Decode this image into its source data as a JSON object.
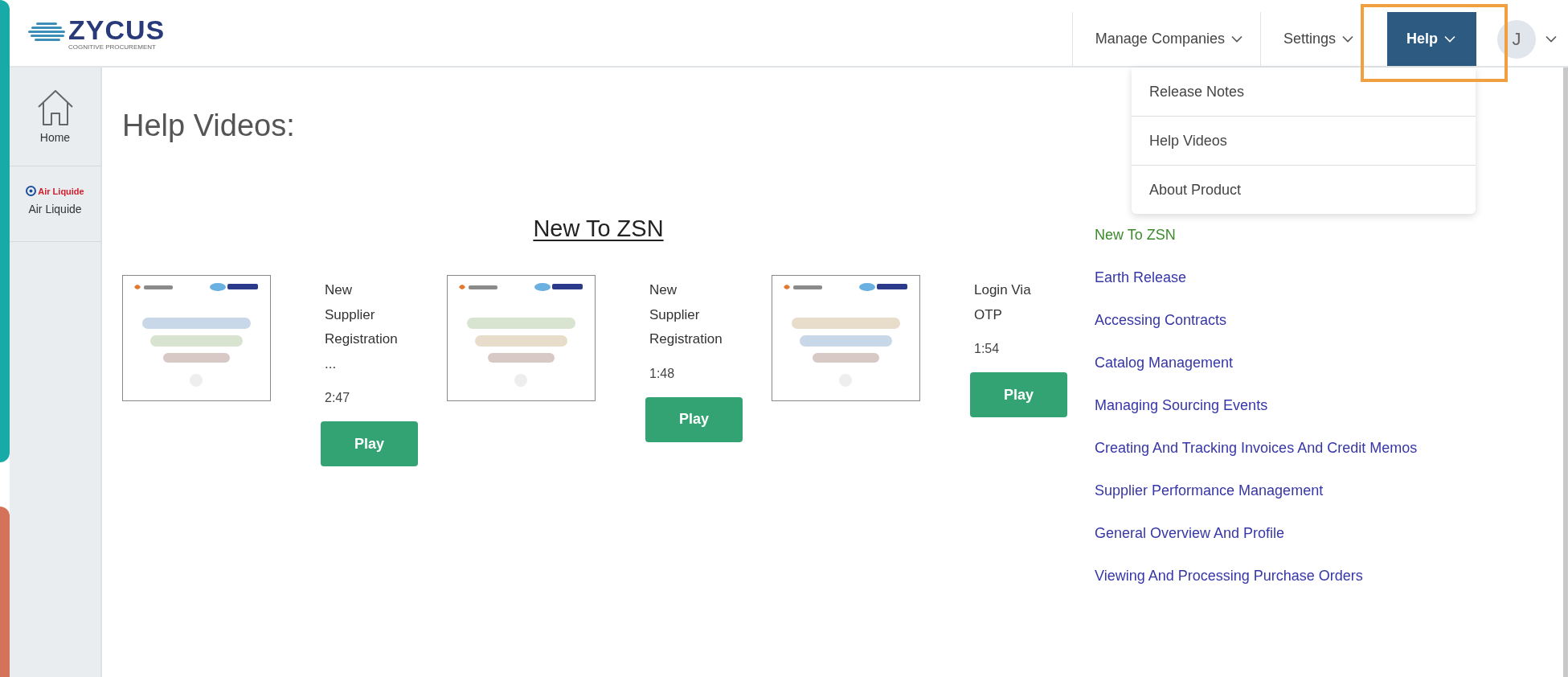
{
  "logo": {
    "name": "ZYCUS",
    "tagline": "COGNITIVE PROCUREMENT"
  },
  "nav": [
    {
      "label": "Manage Companies",
      "selected": false
    },
    {
      "label": "Settings",
      "selected": false
    },
    {
      "label": "Help",
      "selected": true
    }
  ],
  "user": {
    "initial": "J"
  },
  "help_menu": [
    "Release Notes",
    "Help Videos",
    "About Product"
  ],
  "sidebar": [
    {
      "kind": "home",
      "label": "Home"
    },
    {
      "kind": "company",
      "label": "Air Liquide",
      "logo_text": "Air Liquide"
    }
  ],
  "page_title": "Help Videos:",
  "section_title": "New To ZSN",
  "videos": [
    {
      "kind": "picture",
      "title": "New Supplier Registration ...",
      "duration": "2:47",
      "button": "Play"
    },
    {
      "kind": "picture",
      "title": "New Supplier Registration",
      "duration": "1:48",
      "button": "Play"
    },
    {
      "kind": "picture",
      "title": "Login Via OTP",
      "duration": "1:54",
      "button": "Play"
    }
  ],
  "topics": [
    {
      "label": "New To ZSN",
      "selected": true
    },
    {
      "label": "Earth Release",
      "selected": false
    },
    {
      "label": "Accessing Contracts",
      "selected": false
    },
    {
      "label": "Catalog Management",
      "selected": false
    },
    {
      "label": "Managing Sourcing Events",
      "selected": false
    },
    {
      "label": "Creating And Tracking Invoices And Credit Memos",
      "selected": false
    },
    {
      "label": "Supplier Performance Management",
      "selected": false
    },
    {
      "label": "General Overview And Profile",
      "selected": false
    },
    {
      "label": "Viewing And Processing Purchase Orders",
      "selected": false
    }
  ]
}
